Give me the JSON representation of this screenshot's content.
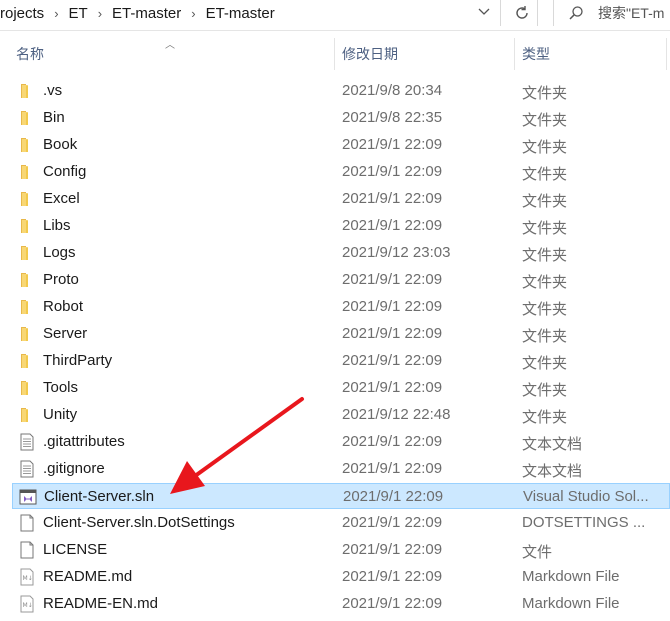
{
  "address": {
    "crumbs": [
      "rojects",
      "ET",
      "ET-master",
      "ET-master"
    ],
    "search_placeholder": "搜索\"ET-m"
  },
  "columns": {
    "name": "名称",
    "date": "修改日期",
    "type": "类型"
  },
  "files": [
    {
      "name": ".vs",
      "date": "2021/9/8 20:34",
      "type": "文件夹",
      "icon": "folder-icon"
    },
    {
      "name": "Bin",
      "date": "2021/9/8 22:35",
      "type": "文件夹",
      "icon": "folder-icon"
    },
    {
      "name": "Book",
      "date": "2021/9/1 22:09",
      "type": "文件夹",
      "icon": "folder-icon"
    },
    {
      "name": "Config",
      "date": "2021/9/1 22:09",
      "type": "文件夹",
      "icon": "folder-icon"
    },
    {
      "name": "Excel",
      "date": "2021/9/1 22:09",
      "type": "文件夹",
      "icon": "folder-icon"
    },
    {
      "name": "Libs",
      "date": "2021/9/1 22:09",
      "type": "文件夹",
      "icon": "folder-icon"
    },
    {
      "name": "Logs",
      "date": "2021/9/12 23:03",
      "type": "文件夹",
      "icon": "folder-icon"
    },
    {
      "name": "Proto",
      "date": "2021/9/1 22:09",
      "type": "文件夹",
      "icon": "folder-icon"
    },
    {
      "name": "Robot",
      "date": "2021/9/1 22:09",
      "type": "文件夹",
      "icon": "folder-icon"
    },
    {
      "name": "Server",
      "date": "2021/9/1 22:09",
      "type": "文件夹",
      "icon": "folder-icon"
    },
    {
      "name": "ThirdParty",
      "date": "2021/9/1 22:09",
      "type": "文件夹",
      "icon": "folder-icon"
    },
    {
      "name": "Tools",
      "date": "2021/9/1 22:09",
      "type": "文件夹",
      "icon": "folder-icon"
    },
    {
      "name": "Unity",
      "date": "2021/9/12 22:48",
      "type": "文件夹",
      "icon": "folder-icon"
    },
    {
      "name": ".gitattributes",
      "date": "2021/9/1 22:09",
      "type": "文本文档",
      "icon": "text-document-icon"
    },
    {
      "name": ".gitignore",
      "date": "2021/9/1 22:09",
      "type": "文本文档",
      "icon": "text-document-icon"
    },
    {
      "name": "Client-Server.sln",
      "date": "2021/9/1 22:09",
      "type": "Visual Studio Sol...",
      "icon": "visual-studio-solution-icon",
      "selected": true
    },
    {
      "name": "Client-Server.sln.DotSettings",
      "date": "2021/9/1 22:09",
      "type": "DOTSETTINGS ...",
      "icon": "blank-file-icon"
    },
    {
      "name": "LICENSE",
      "date": "2021/9/1 22:09",
      "type": "文件",
      "icon": "blank-file-icon"
    },
    {
      "name": "README.md",
      "date": "2021/9/1 22:09",
      "type": "Markdown File",
      "icon": "markdown-file-icon"
    },
    {
      "name": "README-EN.md",
      "date": "2021/9/1 22:09",
      "type": "Markdown File",
      "icon": "markdown-file-icon"
    }
  ],
  "colors": {
    "selection": "#cce8ff",
    "selection_border": "#99d1ff",
    "folder": "#f8d775",
    "annotation_arrow": "#e8171d"
  }
}
